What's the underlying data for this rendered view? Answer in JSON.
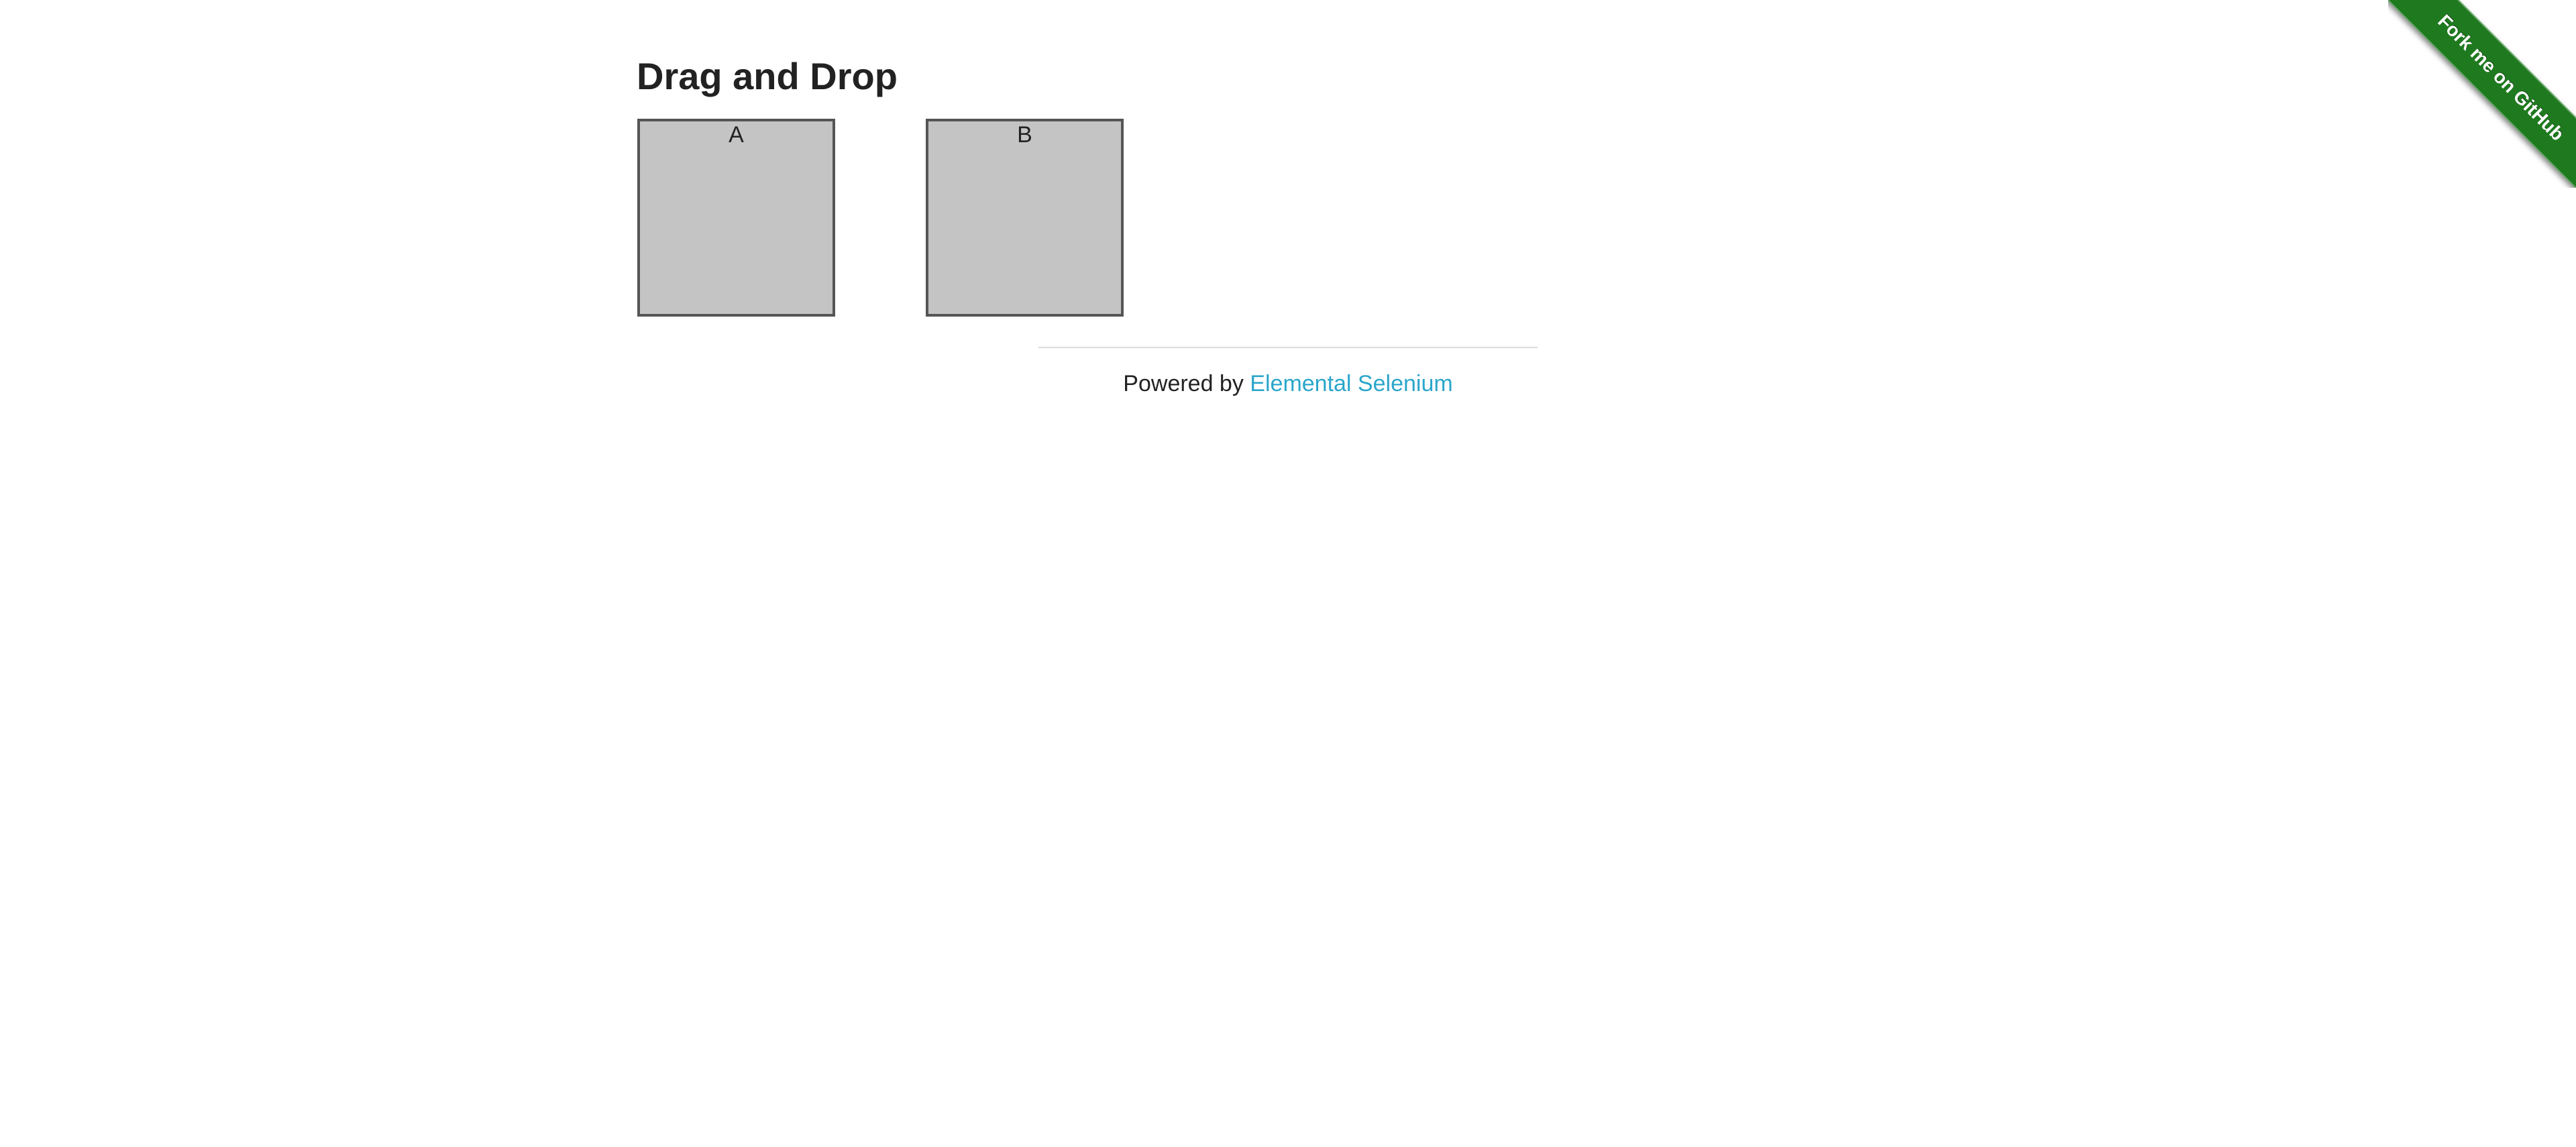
{
  "page": {
    "heading": "Drag and Drop"
  },
  "columns": [
    {
      "label": "A"
    },
    {
      "label": "B"
    }
  ],
  "footer": {
    "prefix": "Powered by",
    "link_text": "Elemental Selenium"
  },
  "ribbon": {
    "text": "Fork me on GitHub",
    "color": "#1f7a1f"
  },
  "colors": {
    "box_fill": "#c4c4c4",
    "box_border": "#555555",
    "link": "#2ba6cb",
    "heading": "#222222"
  }
}
